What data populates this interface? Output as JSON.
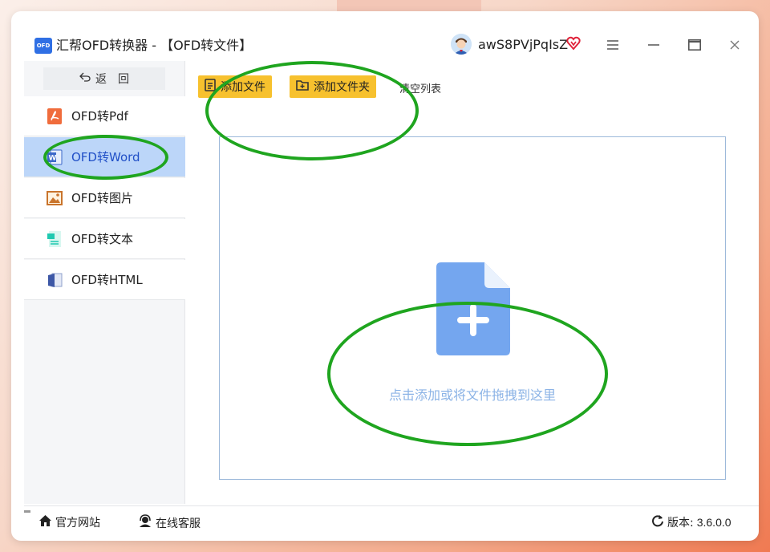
{
  "window": {
    "logo_text": "OFD",
    "title": "汇帮OFD转换器 - 【OFD转文件】",
    "username": "awS8PVjPqIsZ",
    "vip_icon": "vip-heart-icon",
    "controls": [
      "menu-icon",
      "minimize-icon",
      "maximize-icon",
      "close-icon"
    ]
  },
  "sidebar": {
    "back_label": "返　回",
    "items": [
      {
        "label": "OFD转Pdf",
        "icon": "pdf-icon",
        "active": false
      },
      {
        "label": "OFD转Word",
        "icon": "word-icon",
        "active": true
      },
      {
        "label": "OFD转图片",
        "icon": "image-icon",
        "active": false
      },
      {
        "label": "OFD转文本",
        "icon": "text-file-icon",
        "active": false
      },
      {
        "label": "OFD转HTML",
        "icon": "html-icon",
        "active": false
      }
    ]
  },
  "toolbar": {
    "add_file": "添加文件",
    "add_folder": "添加文件夹",
    "clear_list": "清空列表"
  },
  "dropzone": {
    "hint": "点击添加或将文件拖拽到这里",
    "icon": "add-file-icon"
  },
  "footer": {
    "website": "官方网站",
    "support": "在线客服",
    "version_label": "版本:",
    "version_value": "3.6.0.0"
  },
  "colors": {
    "accent_yellow": "#f7c12e",
    "active_nav_bg": "#bcd6f9",
    "active_nav_text": "#2150c7",
    "drop_icon": "#74a6ef",
    "annotation_green": "#1fa51f"
  }
}
